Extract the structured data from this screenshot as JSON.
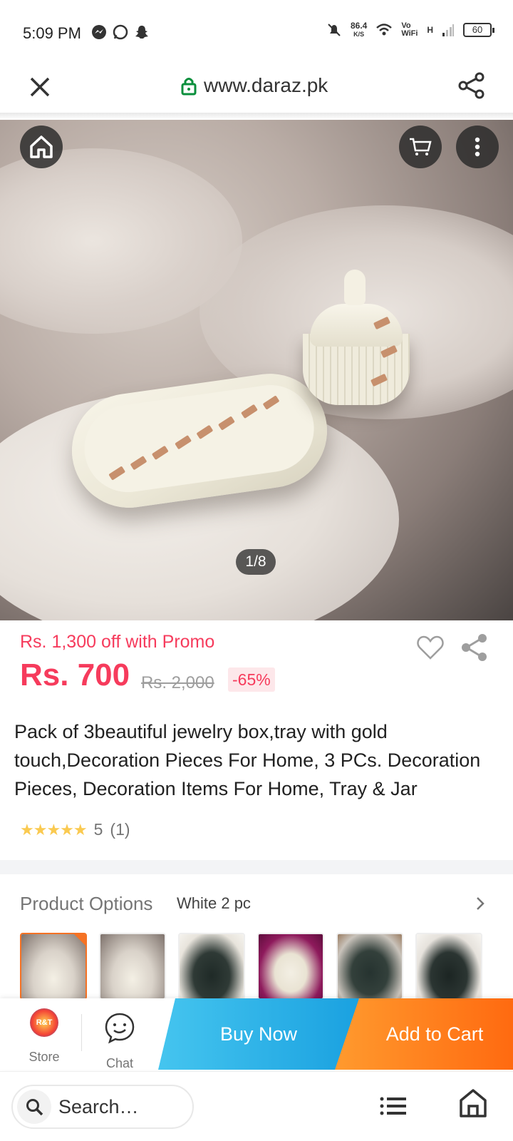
{
  "status_bar": {
    "time": "5:09 PM",
    "net_speed_value": "86.4",
    "net_speed_unit": "K/S",
    "vowifi": "Vo WiFi",
    "signal_type": "H",
    "battery": "60"
  },
  "browser": {
    "url": "www.daraz.pk",
    "close_icon": "close-icon",
    "share_icon": "share-icon",
    "lock_icon": "lock-icon"
  },
  "gallery": {
    "counter": "1/8",
    "current": 1,
    "total": 8
  },
  "product": {
    "promo_text": "Rs. 1,300 off with Promo",
    "price": "Rs. 700",
    "original_price": "Rs. 2,000",
    "discount": "-65%",
    "title": "Pack of 3beautiful jewelry box,tray with gold touch,Decoration Pieces For Home, 3 PCs. Decoration Pieces, Decoration Items For Home, Tray & Jar",
    "rating_score": "5",
    "rating_count": "(1)",
    "stars": 5
  },
  "options": {
    "label": "Product Options",
    "selected": "White 2 pc",
    "thumbnail_count": 6
  },
  "action_bar": {
    "store_label": "Store",
    "store_logo_text": "R&T",
    "chat_label": "Chat",
    "buy_now_label": "Buy Now",
    "add_to_cart_label": "Add to Cart"
  },
  "bottom_nav": {
    "search_placeholder": "Search…"
  },
  "colors": {
    "accent_red": "#f63b5c",
    "buy_now": "#1aa1e0",
    "add_to_cart": "#ff6a10",
    "star": "#faca51"
  }
}
